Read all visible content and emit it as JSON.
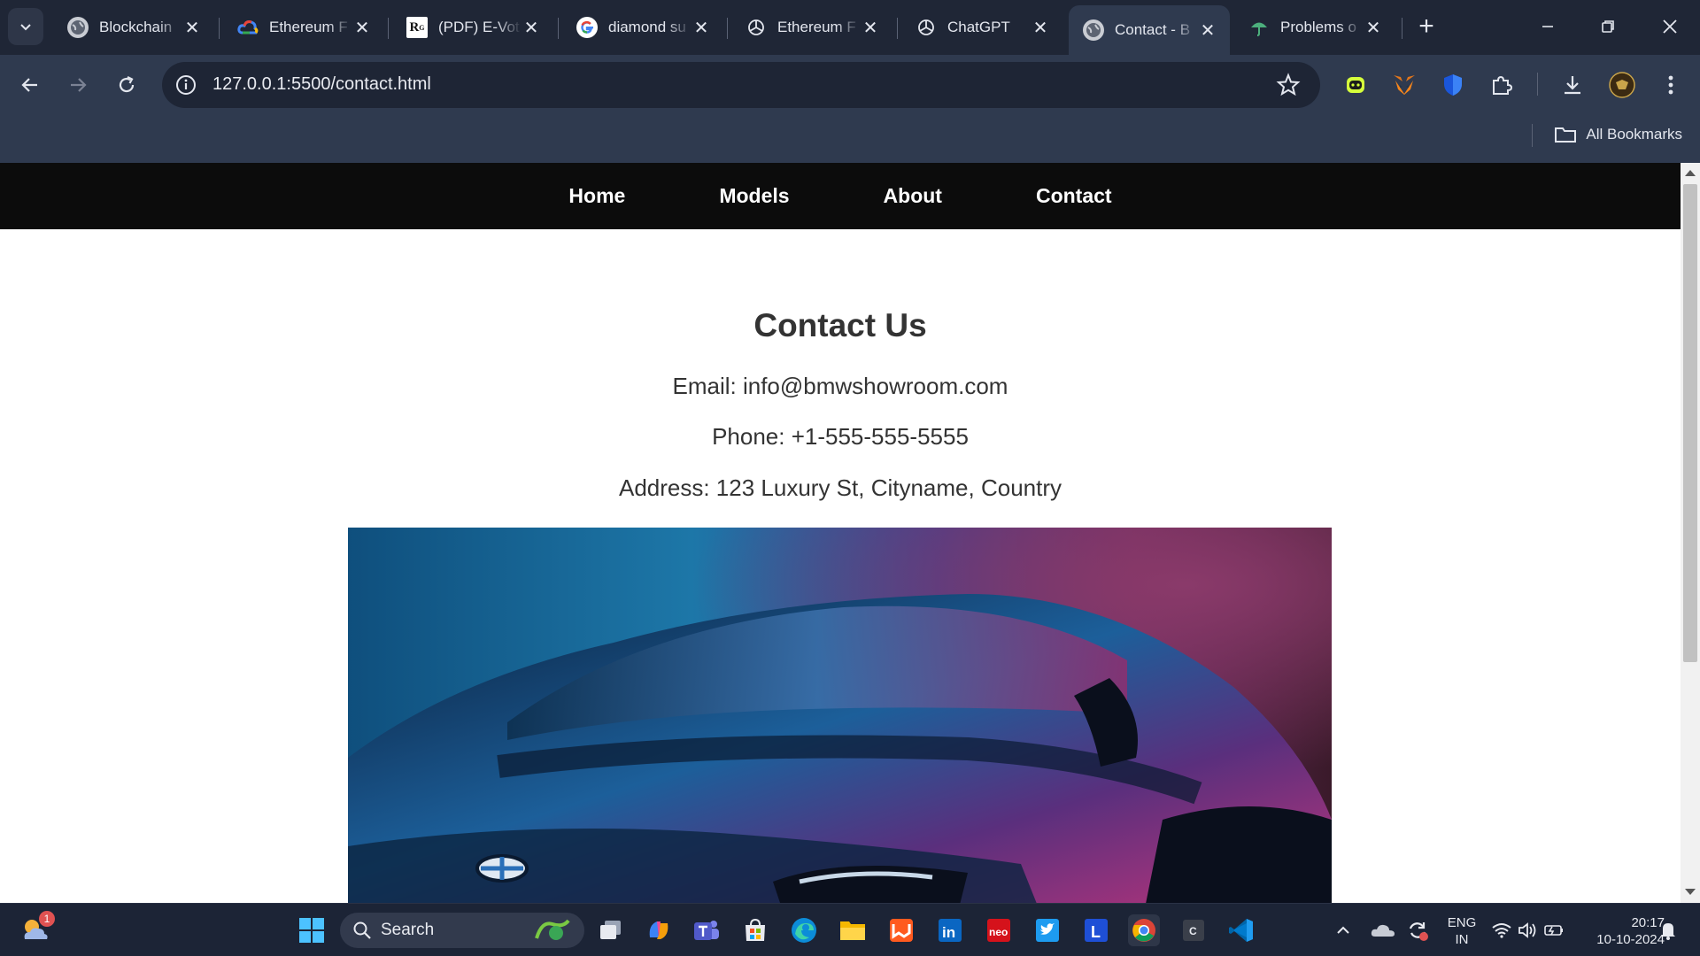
{
  "browser": {
    "tabs": [
      {
        "title": "Blockchain",
        "icon": "globe-icon"
      },
      {
        "title": "Ethereum F",
        "icon": "google-cloud-icon"
      },
      {
        "title": "(PDF) E-Vot",
        "icon": "researchgate-icon"
      },
      {
        "title": "diamond su",
        "icon": "google-icon"
      },
      {
        "title": "Ethereum F",
        "icon": "openai-icon"
      },
      {
        "title": "ChatGPT",
        "icon": "openai-icon"
      },
      {
        "title": "Contact - B",
        "icon": "globe-icon",
        "active": true
      },
      {
        "title": "Problems o",
        "icon": "umbrella-icon"
      }
    ],
    "url": "127.0.0.1:5500/contact.html",
    "bookmarks_label": "All Bookmarks"
  },
  "site": {
    "nav": [
      "Home",
      "Models",
      "About",
      "Contact"
    ],
    "heading": "Contact Us",
    "email": "Email: info@bmwshowroom.com",
    "phone": "Phone: +1-555-555-5555",
    "address": "Address: 123 Luxury St, Cityname, Country"
  },
  "taskbar": {
    "search_label": "Search",
    "lang_line1": "ENG",
    "lang_line2": "IN",
    "time": "20:17",
    "date": "10-10-2024",
    "weather_badge": "1"
  },
  "colors": {
    "chrome_bg": "#1f2636",
    "toolbar_bg": "#2f3a4f",
    "site_nav_bg": "#0c0c0c",
    "text": "#333333"
  }
}
